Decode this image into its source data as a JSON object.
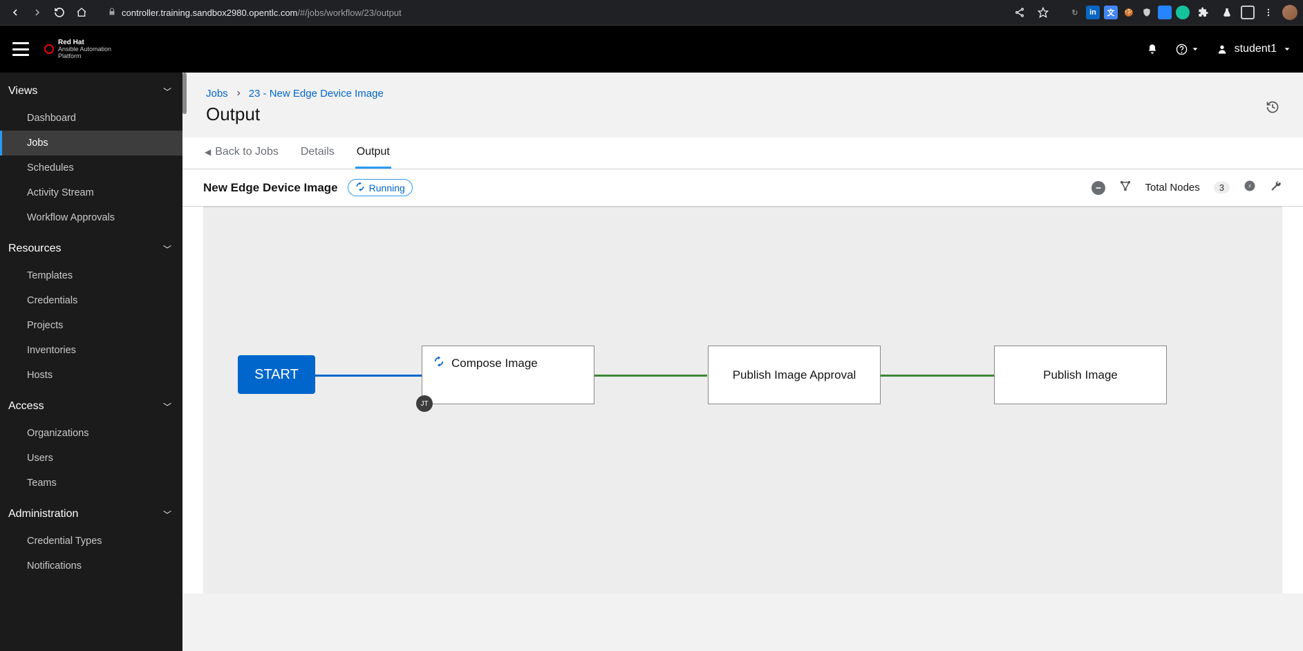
{
  "browser": {
    "url_host": "controller.training.sandbox2980.opentlc.com",
    "url_path": "/#/jobs/workflow/23/output"
  },
  "brand": {
    "line1": "Red Hat",
    "line2": "Ansible Automation",
    "line3": "Platform"
  },
  "header": {
    "username": "student1"
  },
  "sidebar": {
    "sections": [
      {
        "title": "Views",
        "items": [
          "Dashboard",
          "Jobs",
          "Schedules",
          "Activity Stream",
          "Workflow Approvals"
        ],
        "active": "Jobs"
      },
      {
        "title": "Resources",
        "items": [
          "Templates",
          "Credentials",
          "Projects",
          "Inventories",
          "Hosts"
        ]
      },
      {
        "title": "Access",
        "items": [
          "Organizations",
          "Users",
          "Teams"
        ]
      },
      {
        "title": "Administration",
        "items": [
          "Credential Types",
          "Notifications"
        ]
      }
    ]
  },
  "breadcrumb": {
    "root": "Jobs",
    "current": "23 - New Edge Device Image"
  },
  "page": {
    "title": "Output"
  },
  "tabs": {
    "back": "Back to Jobs",
    "details": "Details",
    "output": "Output"
  },
  "job": {
    "name": "New Edge Device Image",
    "status": "Running",
    "total_nodes_label": "Total Nodes",
    "total_nodes": "3"
  },
  "workflow": {
    "start": "START",
    "nodes": [
      {
        "label": "Compose Image",
        "badge": "JT",
        "running": true
      },
      {
        "label": "Publish Image Approval"
      },
      {
        "label": "Publish Image"
      }
    ]
  }
}
